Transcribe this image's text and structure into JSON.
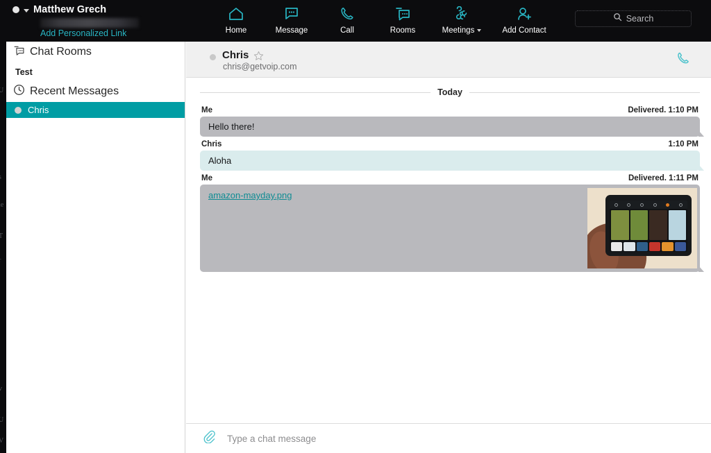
{
  "topbar": {
    "user": {
      "name": "Matthew Grech",
      "status_icon": "status-dot-icon",
      "chevron_icon": "chevron-down-icon",
      "personalized_link_label": "Add Personalized Link"
    },
    "nav": [
      {
        "label": "Home",
        "icon": "home-icon",
        "has_chevron": false
      },
      {
        "label": "Message",
        "icon": "message-icon",
        "has_chevron": false
      },
      {
        "label": "Call",
        "icon": "phone-icon",
        "has_chevron": false
      },
      {
        "label": "Rooms",
        "icon": "rooms-icon",
        "has_chevron": false
      },
      {
        "label": "Meetings",
        "icon": "meetings-icon",
        "has_chevron": true
      },
      {
        "label": "Add Contact",
        "icon": "add-contact-icon",
        "has_chevron": false
      }
    ],
    "search": {
      "placeholder": "Search",
      "icon": "search-icon",
      "value": ""
    }
  },
  "sidebar": {
    "chat_rooms": {
      "header_label": "Chat Rooms",
      "header_icon": "rooms-icon",
      "rooms": [
        {
          "label": "Test"
        }
      ]
    },
    "recent_messages": {
      "header_label": "Recent Messages",
      "header_icon": "clock-icon",
      "contacts": [
        {
          "label": "Chris",
          "selected": true,
          "presence": "offline"
        }
      ]
    }
  },
  "chat_header": {
    "name": "Chris",
    "email": "chris@getvoip.com",
    "presence_icon": "status-dot-icon",
    "favorite_icon": "star-icon",
    "call_icon": "phone-icon"
  },
  "conversation": {
    "day_label": "Today",
    "messages": [
      {
        "sender": "Me",
        "meta_right": "Delivered.  1:10 PM",
        "status": "Delivered.",
        "time": "1:10 PM",
        "text": "Hello there!",
        "side": "me"
      },
      {
        "sender": "Chris",
        "meta_right": "1:10 PM",
        "status": "",
        "time": "1:10 PM",
        "text": "Aloha",
        "side": "them"
      },
      {
        "sender": "Me",
        "meta_right": "Delivered.  1:11 PM",
        "status": "Delivered.",
        "time": "1:11 PM",
        "attachment_name": "amazon-mayday.png",
        "side": "me"
      }
    ]
  },
  "composer": {
    "placeholder": "Type a chat message",
    "attach_icon": "paperclip-icon",
    "value": ""
  },
  "colors": {
    "accent_teal": "#29b6c4",
    "selected_teal": "#009da4",
    "bubble_me": "#b9b9bd",
    "bubble_them": "#daeced",
    "topbar_bg": "#0c0c0e",
    "link_teal": "#0f8c93"
  }
}
